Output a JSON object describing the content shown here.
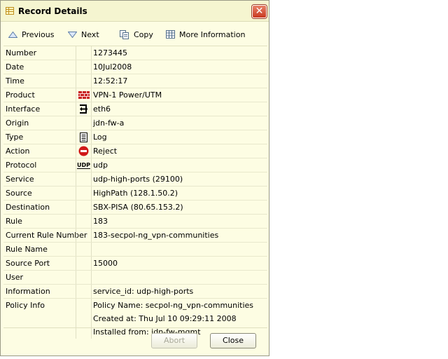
{
  "window": {
    "title": "Record Details",
    "close_glyph": "✕"
  },
  "toolbar": {
    "previous": "Previous",
    "next": "Next",
    "copy": "Copy",
    "more_info": "More Information"
  },
  "rows": [
    {
      "label": "Number",
      "value": "1273445"
    },
    {
      "label": "Date",
      "value": "10Jul2008"
    },
    {
      "label": "Time",
      "value": "12:52:17"
    },
    {
      "label": "Product",
      "value": "VPN-1 Power/UTM",
      "icon": "firewall-brick-icon"
    },
    {
      "label": "Interface",
      "value": "eth6",
      "icon": "interface-exit-icon"
    },
    {
      "label": "Origin",
      "value": "jdn-fw-a"
    },
    {
      "label": "Type",
      "value": "Log",
      "icon": "log-document-icon"
    },
    {
      "label": "Action",
      "value": "Reject",
      "icon": "reject-no-entry-icon"
    },
    {
      "label": "Protocol",
      "value": "udp",
      "icon": "udp-icon",
      "icon_text": "UDP"
    },
    {
      "label": "Service",
      "value": "udp-high-ports (29100)"
    },
    {
      "label": "Source",
      "value": "HighPath (128.1.50.2)"
    },
    {
      "label": "Destination",
      "value": "SBX-PISA (80.65.153.2)"
    },
    {
      "label": "Rule",
      "value": "183"
    },
    {
      "label": "Current Rule Number",
      "value": "183-secpol-ng_vpn-communities"
    },
    {
      "label": "Rule Name",
      "value": ""
    },
    {
      "label": "Source Port",
      "value": "15000"
    },
    {
      "label": "User",
      "value": ""
    },
    {
      "label": "Information",
      "value": "service_id: udp-high-ports"
    }
  ],
  "policy": {
    "label": "Policy Info",
    "lines": [
      "Policy Name: secpol-ng_vpn-communities",
      "Created at: Thu Jul 10 09:29:11 2008",
      "Installed from: jdn-fw-mgmt"
    ]
  },
  "buttons": {
    "abort": "Abort",
    "close": "Close"
  },
  "colors": {
    "background": "#fdfde3",
    "close_red": "#c8381f",
    "reject_red": "#d01818"
  }
}
